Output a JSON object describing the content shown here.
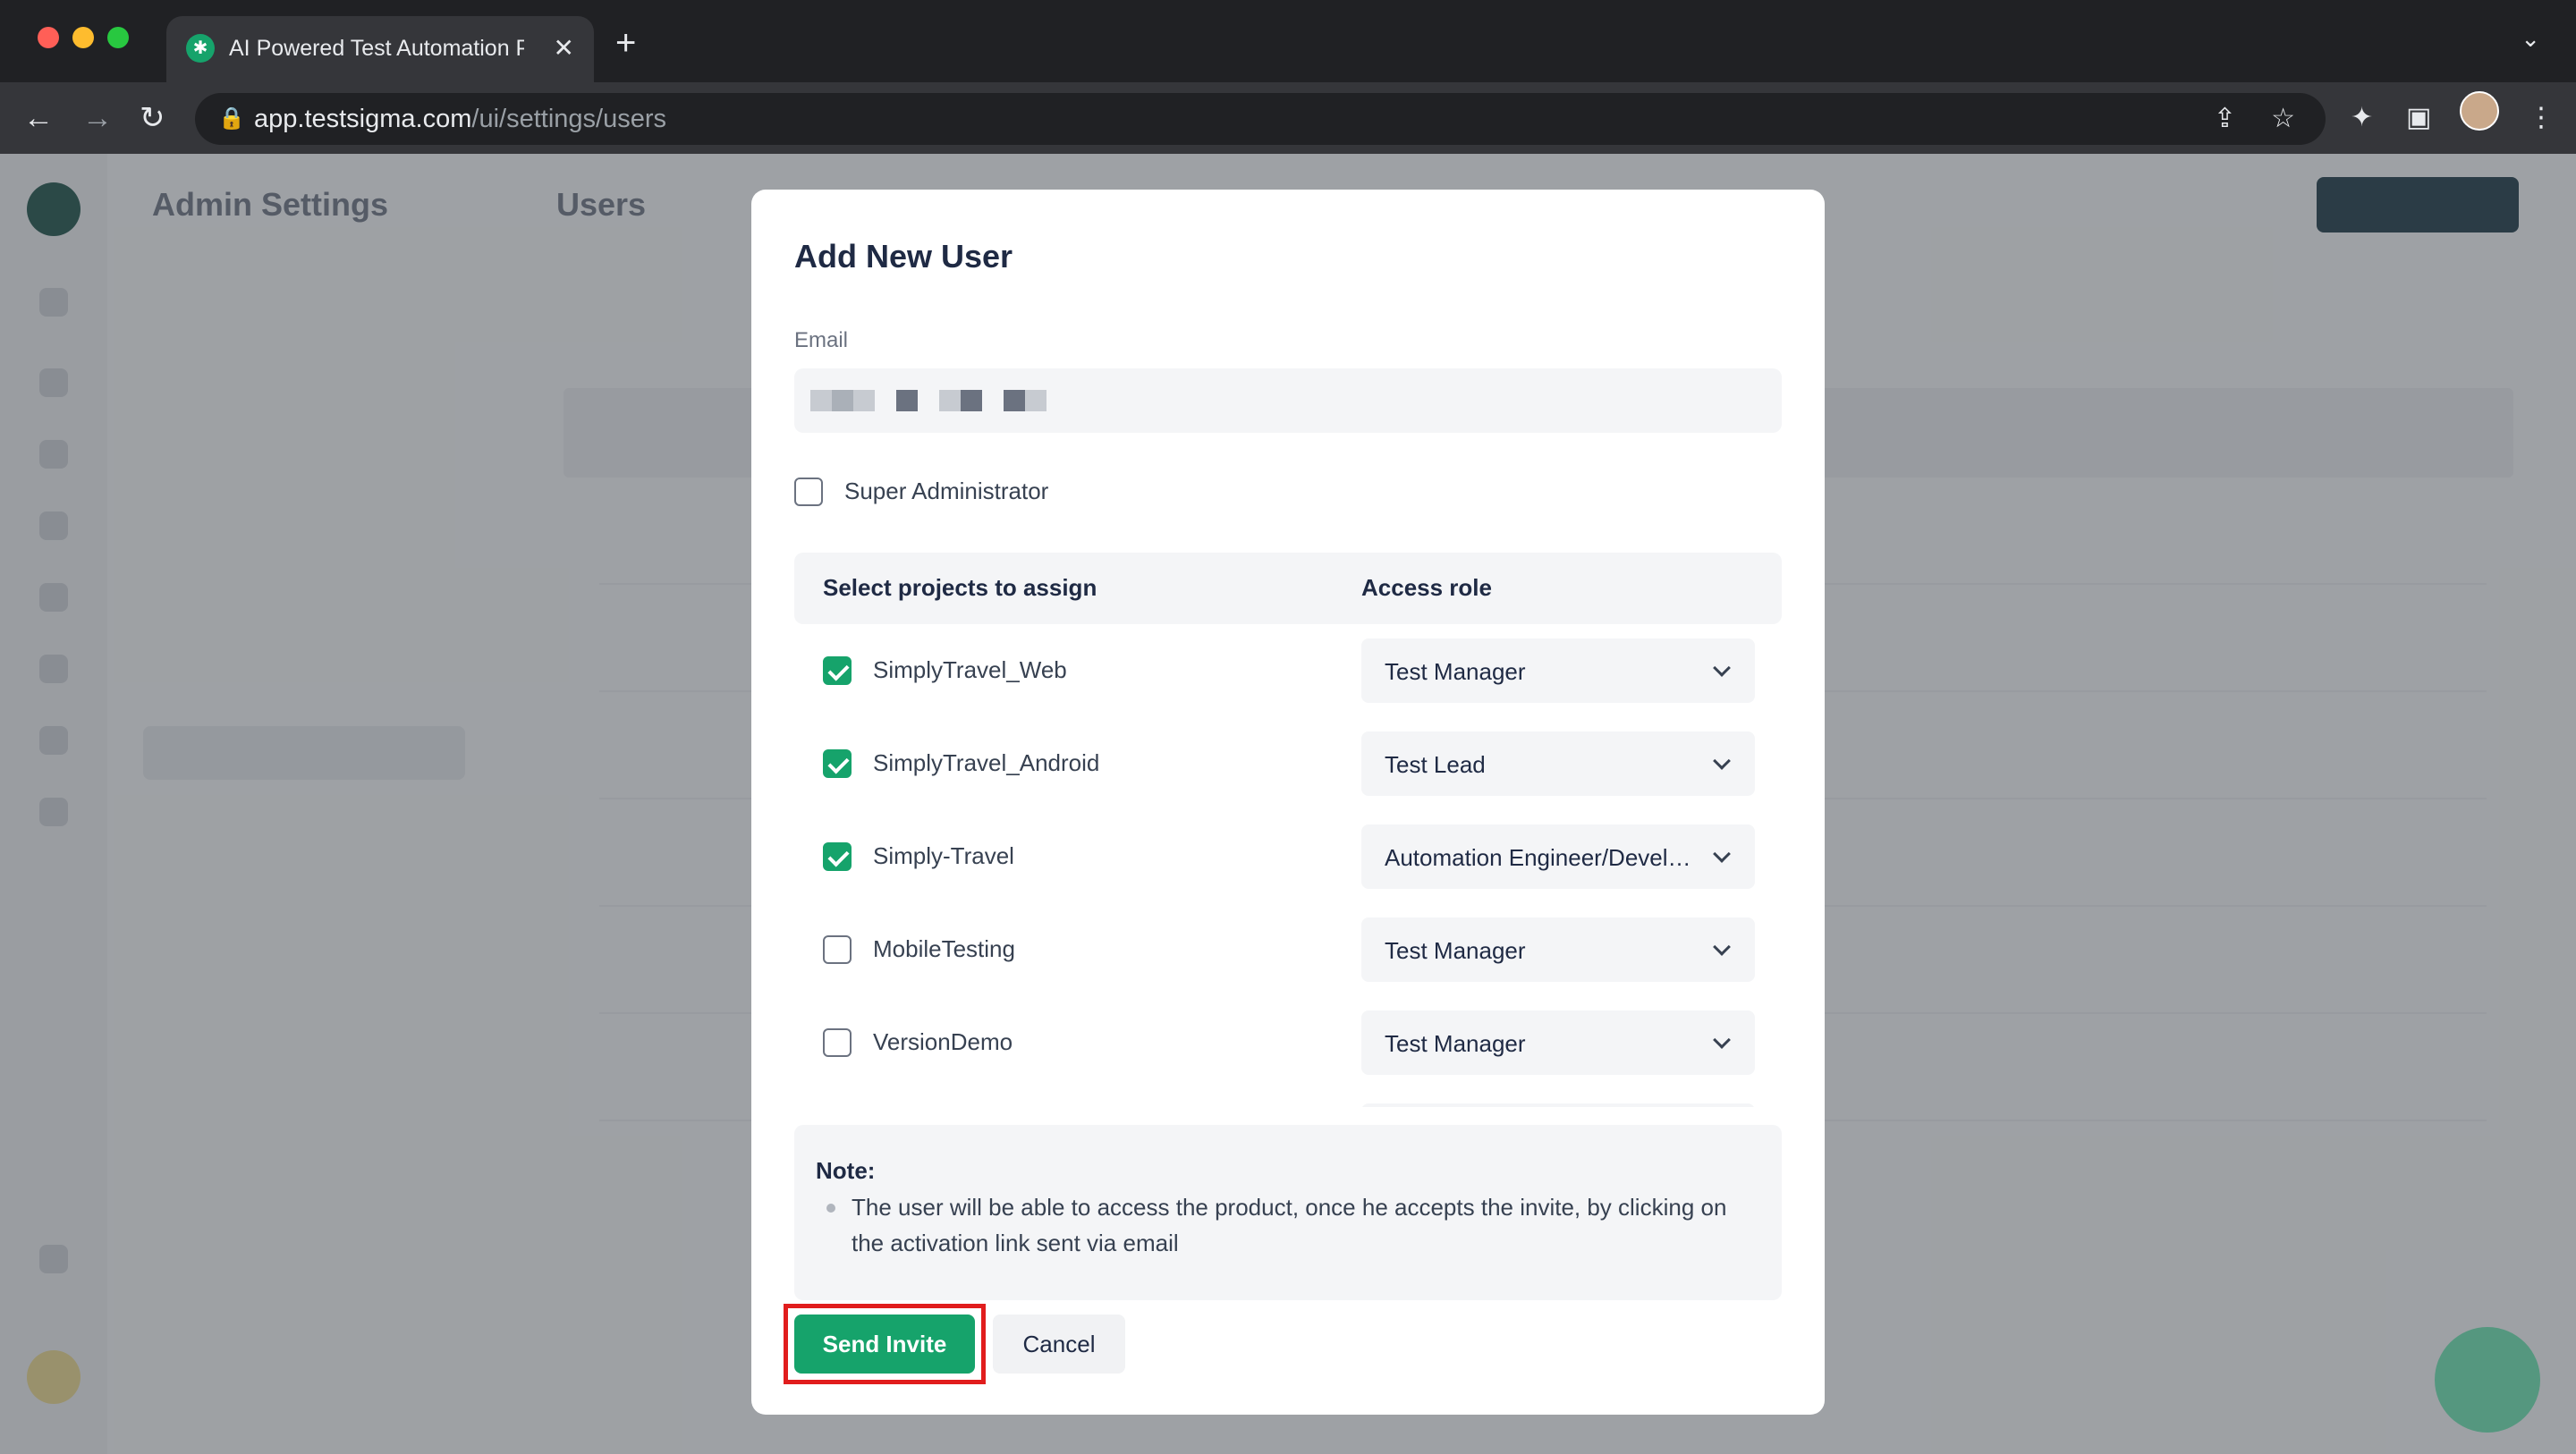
{
  "browser": {
    "tab_title": "AI Powered Test Automation Platform",
    "tab_close": "✕",
    "new_tab": "+",
    "url_host": "app.testsigma.com",
    "url_path": "/ui/settings/users"
  },
  "icons": {
    "back": "←",
    "forward": "→",
    "reload": "↻",
    "lock": "🔒",
    "share": "⇪",
    "star": "☆",
    "extensions": "✦",
    "sidepanel": "▣",
    "menu": "⋮",
    "tab_list": "⌄",
    "favicon": "✱"
  },
  "background": {
    "sidebar_title": "Admin Settings",
    "main_title": "Users"
  },
  "modal": {
    "title": "Add New User",
    "email_label": "Email",
    "super_admin_label": "Super Administrator",
    "col_projects": "Select projects to assign",
    "col_role": "Access role",
    "projects": [
      {
        "name": "SimplyTravel_Web",
        "checked": true,
        "role": "Test Manager"
      },
      {
        "name": "SimplyTravel_Android",
        "checked": true,
        "role": "Test Lead"
      },
      {
        "name": "Simply-Travel",
        "checked": true,
        "role": "Automation Engineer/Developer"
      },
      {
        "name": "MobileTesting",
        "checked": false,
        "role": "Test Manager"
      },
      {
        "name": "VersionDemo",
        "checked": false,
        "role": "Test Manager"
      }
    ],
    "note_title": "Note:",
    "note_text": "The user will be able to access the product, once he accepts the invite, by clicking on the activation link sent via email",
    "send_label": "Send Invite",
    "cancel_label": "Cancel"
  },
  "colors": {
    "accent_green": "#16a36b",
    "highlight_red": "#e11d1d"
  }
}
